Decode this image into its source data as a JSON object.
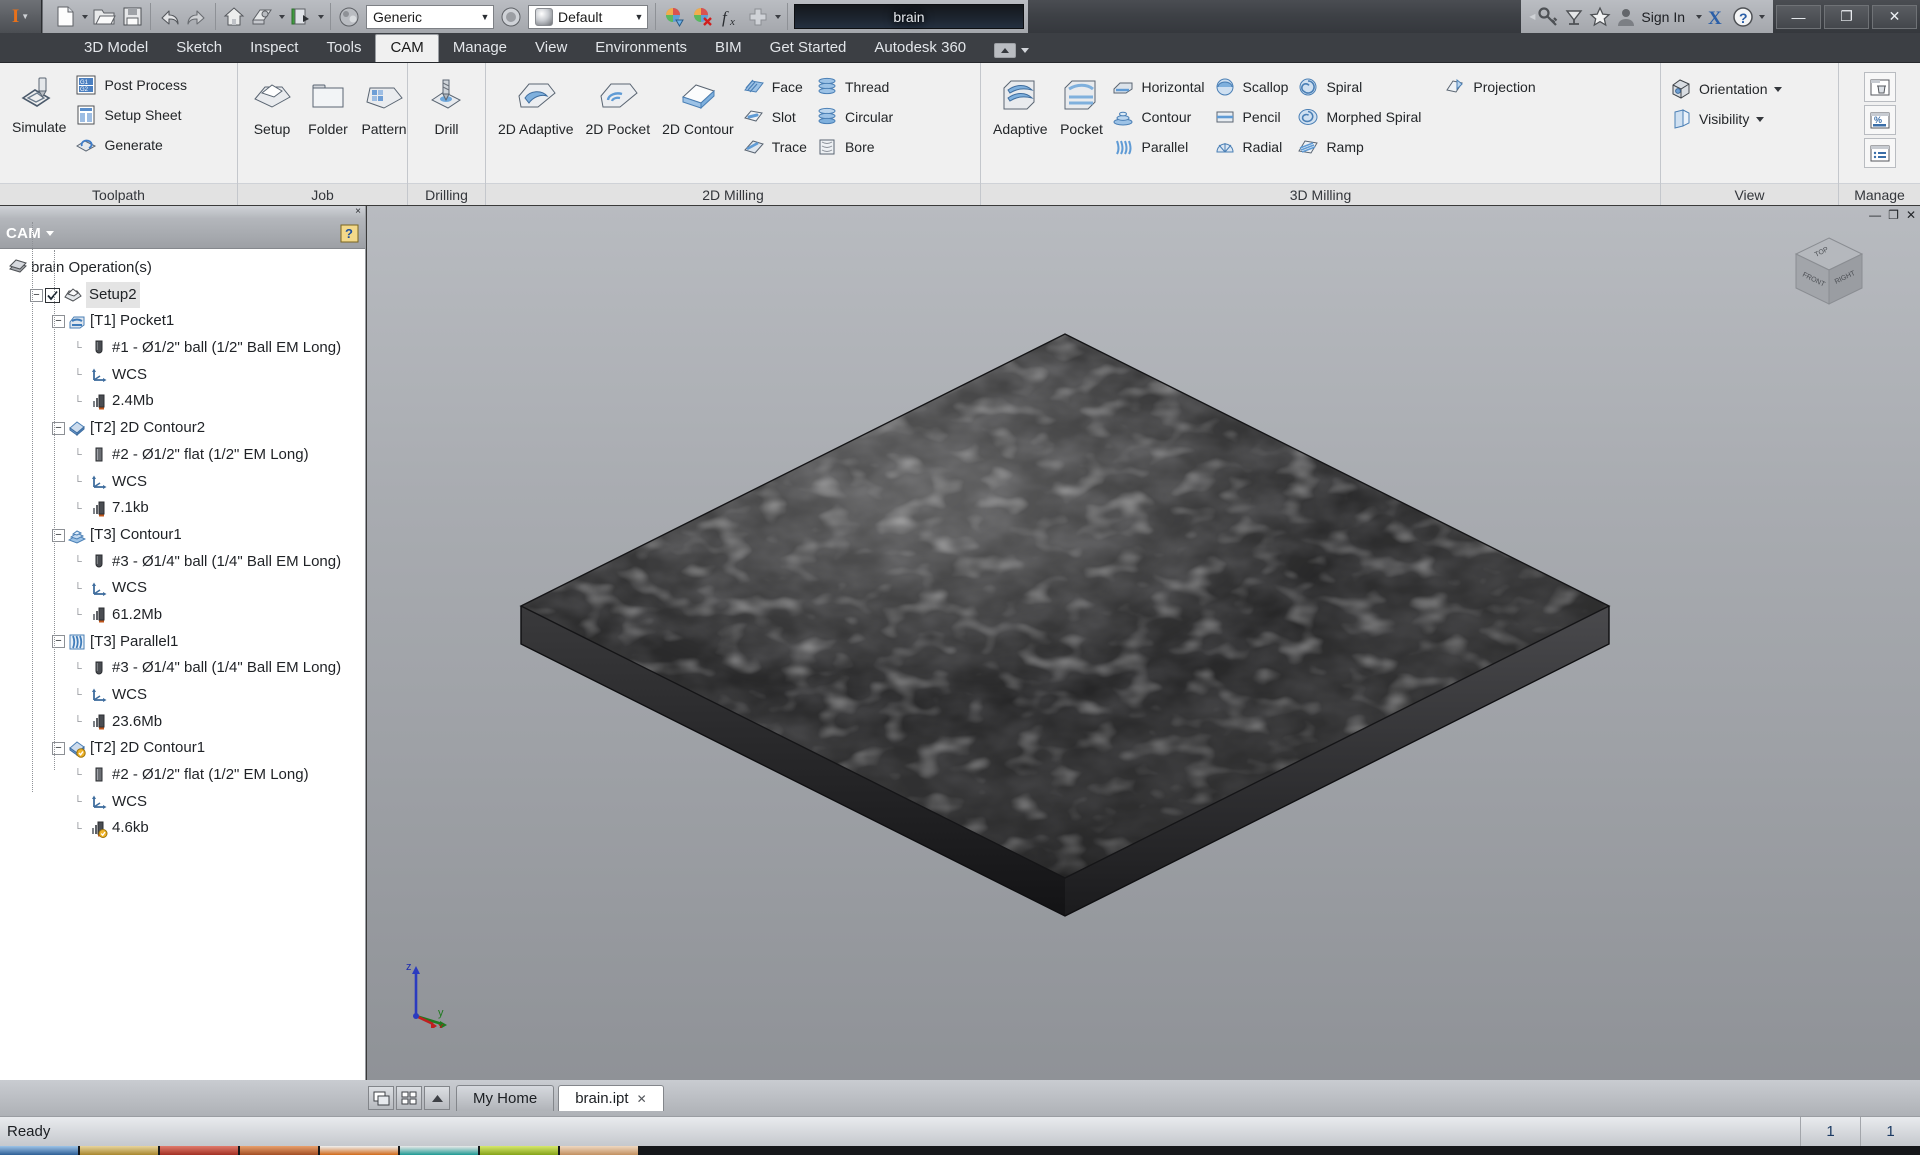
{
  "titlebar": {
    "app_mark": "I",
    "quick_access": [
      {
        "name": "new-file",
        "label": "New"
      },
      {
        "name": "open-file",
        "label": "Open"
      },
      {
        "name": "save-file",
        "label": "Save"
      },
      {
        "name": "undo",
        "label": "Undo"
      },
      {
        "name": "redo",
        "label": "Redo"
      },
      {
        "name": "home",
        "label": "Home"
      },
      {
        "name": "return",
        "label": "Return"
      },
      {
        "name": "appearance",
        "label": "Appearance"
      },
      {
        "name": "material-browser",
        "label": "Material"
      }
    ],
    "material_combo": "Generic",
    "appearance_combo": "Default",
    "search_value": "brain",
    "signin_label": "Sign In",
    "window_buttons": {
      "minimize": "—",
      "restore": "❐",
      "close": "✕"
    },
    "help_label": "?",
    "exchange_label": "X"
  },
  "ribbon_tabs": {
    "items": [
      {
        "label": "3D Model",
        "active": false
      },
      {
        "label": "Sketch",
        "active": false
      },
      {
        "label": "Inspect",
        "active": false
      },
      {
        "label": "Tools",
        "active": false
      },
      {
        "label": "CAM",
        "active": true
      },
      {
        "label": "Manage",
        "active": false
      },
      {
        "label": "View",
        "active": false
      },
      {
        "label": "Environments",
        "active": false
      },
      {
        "label": "BIM",
        "active": false
      },
      {
        "label": "Get Started",
        "active": false
      },
      {
        "label": "Autodesk 360",
        "active": false
      }
    ]
  },
  "ribbon": {
    "panels": [
      {
        "title": "Toolpath",
        "big": [
          {
            "label": "Simulate",
            "icon": "simulate-icon"
          }
        ],
        "small": [
          {
            "label": "Post Process",
            "icon": "post-process-icon"
          },
          {
            "label": "Setup Sheet",
            "icon": "setup-sheet-icon"
          },
          {
            "label": "Generate",
            "icon": "generate-icon"
          }
        ]
      },
      {
        "title": "Job",
        "big": [
          {
            "label": "Setup",
            "icon": "setup-icon"
          },
          {
            "label": "Folder",
            "icon": "folder-icon"
          },
          {
            "label": "Pattern",
            "icon": "pattern-icon"
          }
        ],
        "small": []
      },
      {
        "title": "Drilling",
        "big": [
          {
            "label": "Drill",
            "icon": "drill-icon"
          }
        ],
        "small": []
      },
      {
        "title": "2D Milling",
        "big": [
          {
            "label": "2D Adaptive",
            "icon": "adaptive2d-icon"
          },
          {
            "label": "2D Pocket",
            "icon": "pocket2d-icon"
          },
          {
            "label": "2D Contour",
            "icon": "contour2d-icon"
          }
        ],
        "small_cols": [
          [
            {
              "label": "Face",
              "icon": "face-icon"
            },
            {
              "label": "Slot",
              "icon": "slot-icon"
            },
            {
              "label": "Trace",
              "icon": "trace-icon"
            }
          ],
          [
            {
              "label": "Thread",
              "icon": "thread-icon"
            },
            {
              "label": "Circular",
              "icon": "circular-icon"
            },
            {
              "label": "Bore",
              "icon": "bore-icon"
            }
          ]
        ]
      },
      {
        "title": "3D Milling",
        "big": [
          {
            "label": "Adaptive",
            "icon": "adaptive3d-icon"
          },
          {
            "label": "Pocket",
            "icon": "pocket3d-icon"
          }
        ],
        "small_cols": [
          [
            {
              "label": "Horizontal",
              "icon": "horizontal-icon"
            },
            {
              "label": "Contour",
              "icon": "contour3d-icon"
            },
            {
              "label": "Parallel",
              "icon": "parallel-icon"
            }
          ],
          [
            {
              "label": "Scallop",
              "icon": "scallop-icon"
            },
            {
              "label": "Pencil",
              "icon": "pencil-icon"
            },
            {
              "label": "Radial",
              "icon": "radial-icon"
            }
          ],
          [
            {
              "label": "Spiral",
              "icon": "spiral-icon"
            },
            {
              "label": "Morphed Spiral",
              "icon": "morphed-spiral-icon"
            },
            {
              "label": "Ramp",
              "icon": "ramp-icon"
            }
          ],
          [
            {
              "label": "Projection",
              "icon": "projection-icon"
            }
          ]
        ]
      },
      {
        "title": "View",
        "big": [],
        "small_cols": [
          [
            {
              "label": "Orientation",
              "icon": "orientation-icon",
              "dropdown": true
            },
            {
              "label": "Visibility",
              "icon": "visibility-icon",
              "dropdown": true
            }
          ]
        ]
      },
      {
        "title": "Manage",
        "buttons": [
          {
            "name": "clear-folder-button",
            "icon": "clear-folder-icon"
          },
          {
            "name": "machining-time-button",
            "icon": "machining-time-icon"
          },
          {
            "name": "tool-library-button",
            "icon": "tool-library-icon"
          }
        ]
      }
    ]
  },
  "browser": {
    "title": "CAM",
    "help_label": "?",
    "close_label": "×",
    "tree": [
      {
        "depth": 0,
        "label": "brain Operation(s)",
        "icon": "document-icon",
        "expander": null,
        "checkbox": false,
        "selected": false
      },
      {
        "depth": 1,
        "label": "Setup2",
        "icon": "setup-icon",
        "expander": "−",
        "checkbox": true,
        "selected": true
      },
      {
        "depth": 2,
        "label": "[T1] Pocket1",
        "icon": "pocket-op-icon",
        "expander": "−",
        "checkbox": false,
        "selected": false
      },
      {
        "depth": 3,
        "label": "#1 - Ø1/2\" ball (1/2\" Ball EM Long)",
        "icon": "ball-tool-icon",
        "expander": null,
        "checkbox": false,
        "selected": false
      },
      {
        "depth": 3,
        "label": "WCS",
        "icon": "wcs-icon",
        "expander": null,
        "checkbox": false,
        "selected": false
      },
      {
        "depth": 3,
        "label": "2.4Mb",
        "icon": "toolpath-size-icon",
        "expander": null,
        "checkbox": false,
        "selected": false
      },
      {
        "depth": 2,
        "label": "[T2] 2D Contour2",
        "icon": "contour2d-op-icon",
        "expander": "−",
        "checkbox": false,
        "selected": false
      },
      {
        "depth": 3,
        "label": "#2 - Ø1/2\" flat (1/2\" EM Long)",
        "icon": "flat-tool-icon",
        "expander": null,
        "checkbox": false,
        "selected": false
      },
      {
        "depth": 3,
        "label": "WCS",
        "icon": "wcs-icon",
        "expander": null,
        "checkbox": false,
        "selected": false
      },
      {
        "depth": 3,
        "label": "7.1kb",
        "icon": "toolpath-size-icon",
        "expander": null,
        "checkbox": false,
        "selected": false
      },
      {
        "depth": 2,
        "label": "[T3] Contour1",
        "icon": "contour3d-op-icon",
        "expander": "−",
        "checkbox": false,
        "selected": false
      },
      {
        "depth": 3,
        "label": "#3 - Ø1/4\" ball (1/4\" Ball EM Long)",
        "icon": "ball-tool-icon",
        "expander": null,
        "checkbox": false,
        "selected": false
      },
      {
        "depth": 3,
        "label": "WCS",
        "icon": "wcs-icon",
        "expander": null,
        "checkbox": false,
        "selected": false
      },
      {
        "depth": 3,
        "label": "61.2Mb",
        "icon": "toolpath-size-icon",
        "expander": null,
        "checkbox": false,
        "selected": false
      },
      {
        "depth": 2,
        "label": "[T3] Parallel1",
        "icon": "parallel-op-icon",
        "expander": "−",
        "checkbox": false,
        "selected": false
      },
      {
        "depth": 3,
        "label": "#3 - Ø1/4\" ball (1/4\" Ball EM Long)",
        "icon": "ball-tool-icon",
        "expander": null,
        "checkbox": false,
        "selected": false
      },
      {
        "depth": 3,
        "label": "WCS",
        "icon": "wcs-icon",
        "expander": null,
        "checkbox": false,
        "selected": false
      },
      {
        "depth": 3,
        "label": "23.6Mb",
        "icon": "toolpath-size-icon",
        "expander": null,
        "checkbox": false,
        "selected": false
      },
      {
        "depth": 2,
        "label": "[T2] 2D Contour1",
        "icon": "contour2d-warn-op-icon",
        "expander": "−",
        "checkbox": false,
        "selected": false
      },
      {
        "depth": 3,
        "label": "#2 - Ø1/2\" flat (1/2\" EM Long)",
        "icon": "flat-tool-icon",
        "expander": null,
        "checkbox": false,
        "selected": false
      },
      {
        "depth": 3,
        "label": "WCS",
        "icon": "wcs-icon",
        "expander": null,
        "checkbox": false,
        "selected": false
      },
      {
        "depth": 3,
        "label": "4.6kb",
        "icon": "toolpath-size-warn-icon",
        "expander": null,
        "checkbox": false,
        "selected": false
      }
    ]
  },
  "viewport": {
    "model_description": "Machined 3D brain-texture relief plaque rendered in dark grey metal on a thin rectangular plate",
    "viewcube_faces": {
      "top": "TOP",
      "front": "FRONT",
      "right": "RIGHT"
    },
    "axis_labels": {
      "x": "x",
      "y": "y",
      "z": "z"
    },
    "minimize_label": "—",
    "restore_label": "❐",
    "close_label": "✕"
  },
  "doctabs": {
    "buttons": [
      {
        "name": "cascade-windows-button",
        "label": "cascade-icon"
      },
      {
        "name": "tile-windows-button",
        "label": "tile-icon"
      },
      {
        "name": "scroll-tabs-button",
        "label": "up-arrow-icon"
      }
    ],
    "tabs": [
      {
        "label": "My Home",
        "active": false,
        "closable": false
      },
      {
        "label": "brain.ipt",
        "active": true,
        "closable": true,
        "close_label": "✕"
      }
    ]
  },
  "statusbar": {
    "message": "Ready",
    "cells": [
      "1",
      "1"
    ]
  }
}
